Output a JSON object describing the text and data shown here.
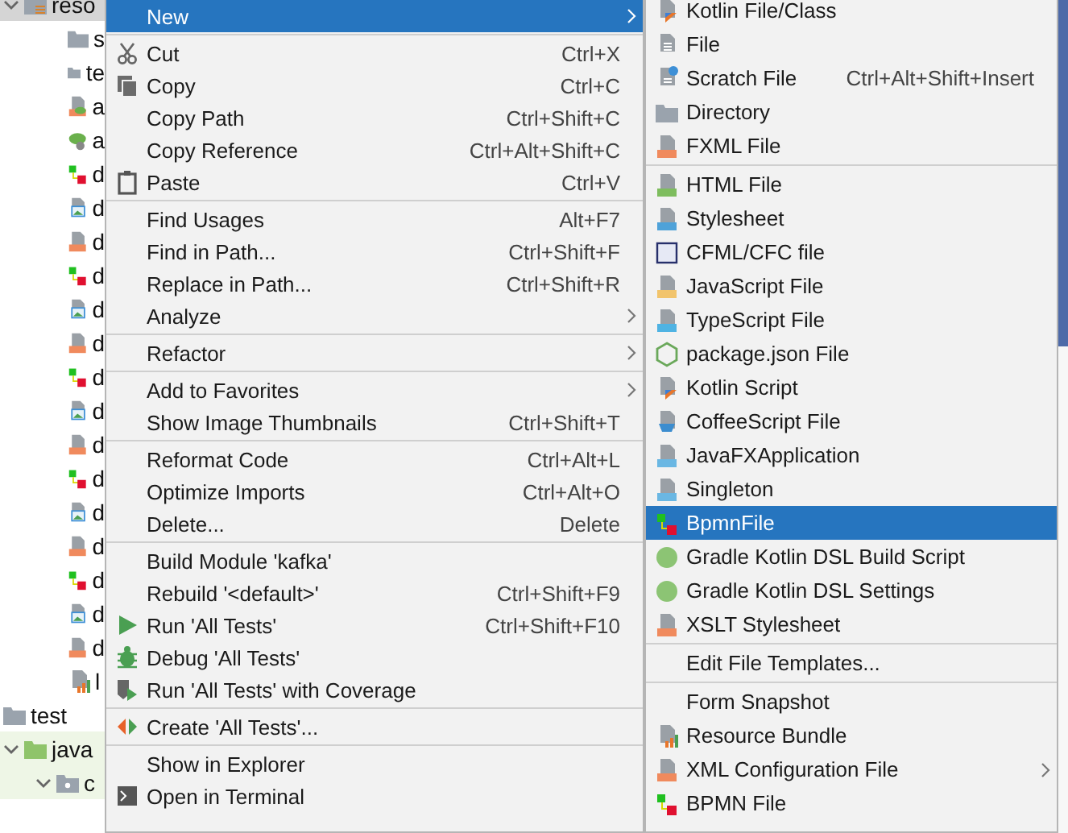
{
  "tree": {
    "items": [
      {
        "label": "reso",
        "kind": "bundle-folder",
        "selected": true,
        "expanded": true,
        "children": [
          {
            "label": "s",
            "kind": "folder",
            "selected": false
          },
          {
            "label": "te",
            "kind": "folder",
            "selected": false
          },
          {
            "label": "a",
            "kind": "spring-xml",
            "selected": false
          },
          {
            "label": "a",
            "kind": "spring",
            "selected": false
          },
          {
            "label": "d",
            "kind": "bpmn",
            "selected": false
          },
          {
            "label": "d",
            "kind": "image",
            "selected": false
          },
          {
            "label": "d",
            "kind": "xml",
            "selected": false
          },
          {
            "label": "d",
            "kind": "bpmn",
            "selected": false
          },
          {
            "label": "d",
            "kind": "image",
            "selected": false
          },
          {
            "label": "d",
            "kind": "xml",
            "selected": false
          },
          {
            "label": "d",
            "kind": "bpmn",
            "selected": false
          },
          {
            "label": "d",
            "kind": "image",
            "selected": false
          },
          {
            "label": "d",
            "kind": "xml",
            "selected": false
          },
          {
            "label": "d",
            "kind": "bpmn",
            "selected": false
          },
          {
            "label": "d",
            "kind": "image",
            "selected": false
          },
          {
            "label": "d",
            "kind": "xml",
            "selected": false
          },
          {
            "label": "d",
            "kind": "bpmn",
            "selected": false
          },
          {
            "label": "d",
            "kind": "image",
            "selected": false
          },
          {
            "label": "d",
            "kind": "xml",
            "selected": false
          },
          {
            "label": "l",
            "kind": "bundle",
            "selected": false
          }
        ]
      },
      {
        "label": "test",
        "kind": "folder",
        "selected": false,
        "test_sources": true,
        "children": [
          {
            "label": "java",
            "kind": "test-folder",
            "selected": false,
            "expanded": true,
            "children": [
              {
                "label": "c",
                "kind": "package",
                "selected": false,
                "expanded": true
              }
            ]
          }
        ]
      }
    ]
  },
  "context_menu": {
    "groups": [
      [
        {
          "label": "New",
          "selected": true,
          "submenu": true
        }
      ],
      [
        {
          "label": "Cut",
          "shortcut": "Ctrl+X",
          "kind": "cut",
          "selected": false,
          "submenu": false
        },
        {
          "label": "Copy",
          "shortcut": "Ctrl+C",
          "kind": "copy",
          "selected": false,
          "submenu": false
        },
        {
          "label": "Copy Path",
          "shortcut": "Ctrl+Shift+C",
          "selected": false,
          "submenu": false
        },
        {
          "label": "Copy Reference",
          "shortcut": "Ctrl+Alt+Shift+C",
          "selected": false,
          "submenu": false
        },
        {
          "label": "Paste",
          "shortcut": "Ctrl+V",
          "kind": "paste",
          "selected": false,
          "submenu": false
        }
      ],
      [
        {
          "label": "Find Usages",
          "shortcut": "Alt+F7",
          "selected": false,
          "submenu": false
        },
        {
          "label": "Find in Path...",
          "shortcut": "Ctrl+Shift+F",
          "selected": false,
          "submenu": false
        },
        {
          "label": "Replace in Path...",
          "shortcut": "Ctrl+Shift+R",
          "selected": false,
          "submenu": false
        },
        {
          "label": "Analyze",
          "selected": false,
          "submenu": true
        }
      ],
      [
        {
          "label": "Refactor",
          "selected": false,
          "submenu": true
        }
      ],
      [
        {
          "label": "Add to Favorites",
          "selected": false,
          "submenu": true
        },
        {
          "label": "Show Image Thumbnails",
          "shortcut": "Ctrl+Shift+T",
          "selected": false,
          "submenu": false
        }
      ],
      [
        {
          "label": "Reformat Code",
          "shortcut": "Ctrl+Alt+L",
          "selected": false,
          "submenu": false
        },
        {
          "label": "Optimize Imports",
          "shortcut": "Ctrl+Alt+O",
          "selected": false,
          "submenu": false
        },
        {
          "label": "Delete...",
          "shortcut": "Delete",
          "selected": false,
          "submenu": false
        }
      ],
      [
        {
          "label": "Build Module 'kafka'",
          "selected": false,
          "submenu": false
        },
        {
          "label": "Rebuild '<default>'",
          "shortcut": "Ctrl+Shift+F9",
          "selected": false,
          "submenu": false
        },
        {
          "label": "Run 'All Tests'",
          "shortcut": "Ctrl+Shift+F10",
          "kind": "run",
          "selected": false,
          "submenu": false
        },
        {
          "label": "Debug 'All Tests'",
          "kind": "debug",
          "selected": false,
          "submenu": false
        },
        {
          "label": "Run 'All Tests' with Coverage",
          "kind": "coverage",
          "selected": false,
          "submenu": false
        }
      ],
      [
        {
          "label": "Create 'All Tests'...",
          "kind": "create",
          "selected": false,
          "submenu": false
        }
      ],
      [
        {
          "label": "Show in Explorer",
          "selected": false,
          "submenu": false
        },
        {
          "label": "Open in Terminal",
          "kind": "terminal",
          "selected": false,
          "submenu": false
        }
      ]
    ]
  },
  "new_submenu": {
    "groups": [
      [
        {
          "label": "Kotlin File/Class",
          "kind": "kotlin",
          "selected": false,
          "submenu": false
        },
        {
          "label": "File",
          "kind": "file",
          "selected": false,
          "submenu": false
        },
        {
          "label": "Scratch File",
          "shortcut": "Ctrl+Alt+Shift+Insert",
          "kind": "scratch",
          "selected": false,
          "submenu": false
        },
        {
          "label": "Directory",
          "kind": "folder",
          "selected": false,
          "submenu": false
        },
        {
          "label": "FXML File",
          "kind": "xml",
          "selected": false,
          "submenu": false
        }
      ],
      [
        {
          "label": "HTML File",
          "kind": "html",
          "selected": false,
          "submenu": false
        },
        {
          "label": "Stylesheet",
          "kind": "css",
          "selected": false,
          "submenu": false
        },
        {
          "label": "CFML/CFC file",
          "kind": "cf",
          "selected": false,
          "submenu": false
        },
        {
          "label": "JavaScript File",
          "kind": "js",
          "selected": false,
          "submenu": false
        },
        {
          "label": "TypeScript File",
          "kind": "ts",
          "selected": false,
          "submenu": false
        },
        {
          "label": "package.json File",
          "kind": "node",
          "selected": false,
          "submenu": false
        },
        {
          "label": "Kotlin Script",
          "kind": "kotlin",
          "selected": false,
          "submenu": false
        },
        {
          "label": "CoffeeScript File",
          "kind": "coffee",
          "selected": false,
          "submenu": false
        },
        {
          "label": "JavaFXApplication",
          "kind": "java",
          "selected": false,
          "submenu": false
        },
        {
          "label": "Singleton",
          "kind": "java",
          "selected": false,
          "submenu": false
        },
        {
          "label": "BpmnFile",
          "kind": "bpmn",
          "selected": true,
          "submenu": false
        },
        {
          "label": "Gradle Kotlin DSL Build Script",
          "kind": "gradle",
          "selected": false,
          "submenu": false
        },
        {
          "label": "Gradle Kotlin DSL Settings",
          "kind": "gradle",
          "selected": false,
          "submenu": false
        },
        {
          "label": "XSLT Stylesheet",
          "kind": "xml",
          "selected": false,
          "submenu": false
        }
      ],
      [
        {
          "label": "Edit File Templates...",
          "selected": false,
          "submenu": false
        }
      ],
      [
        {
          "label": "Form Snapshot",
          "selected": false,
          "submenu": false
        },
        {
          "label": "Resource Bundle",
          "kind": "bundle",
          "selected": false,
          "submenu": false
        },
        {
          "label": "XML Configuration File",
          "kind": "xml",
          "selected": false,
          "submenu": true
        },
        {
          "label": "BPMN File",
          "kind": "bpmn",
          "selected": false,
          "submenu": false
        }
      ]
    ]
  }
}
